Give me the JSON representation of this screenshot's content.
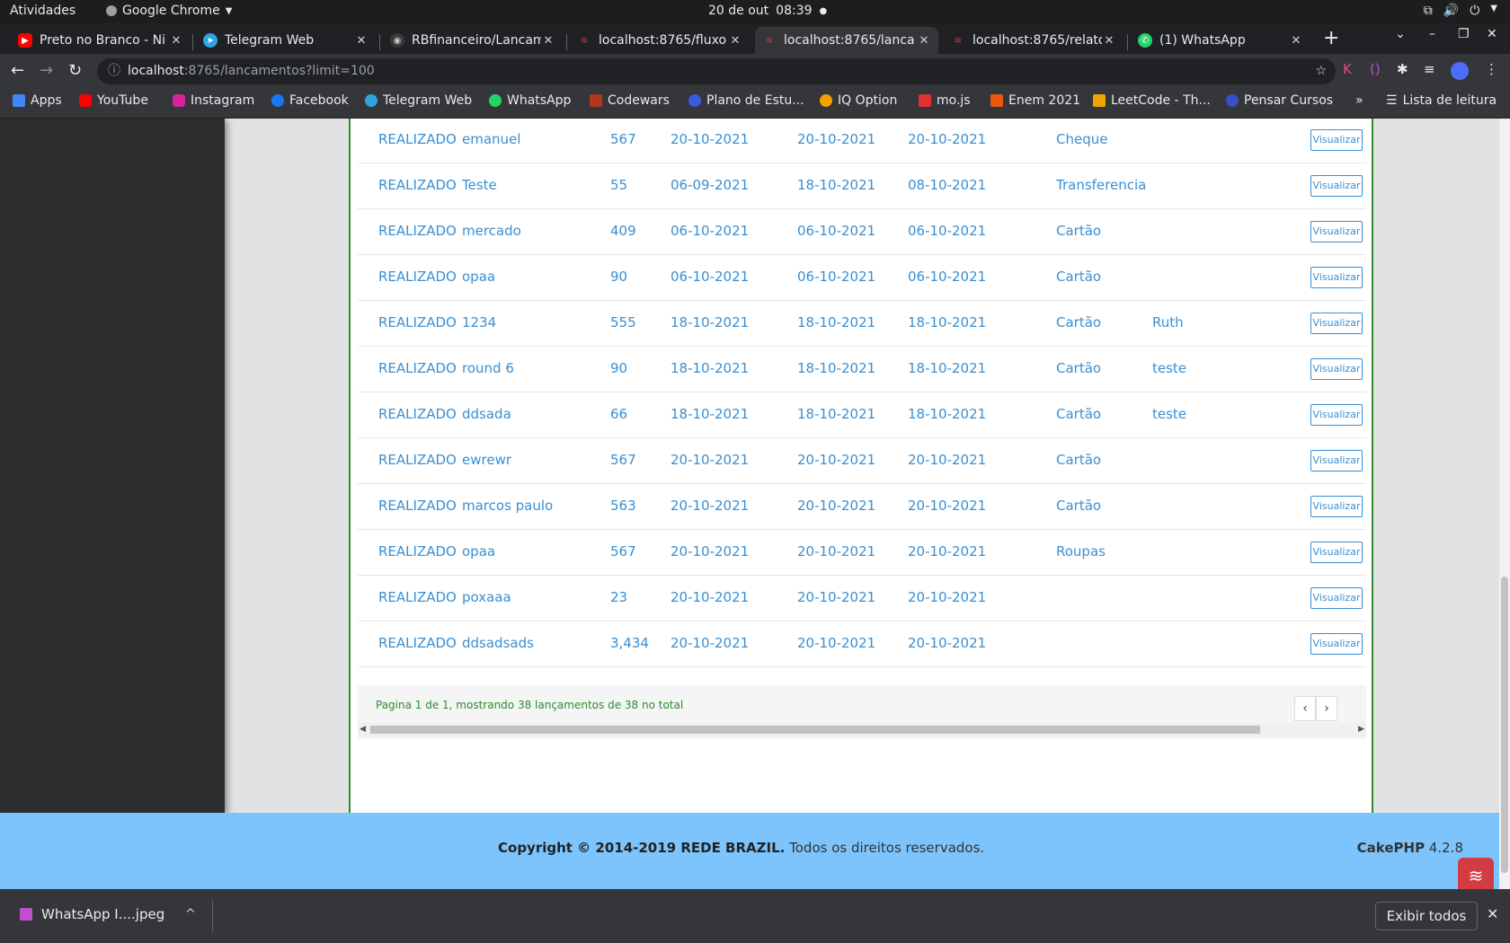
{
  "gnome": {
    "activities": "Atividades",
    "app": "Google Chrome",
    "date": "20 de out",
    "time": "08:39"
  },
  "tabs": [
    {
      "title": "Preto no Branco - Ni",
      "favicon": "youtube-icon",
      "color": "#ff0000"
    },
    {
      "title": "Telegram Web",
      "favicon": "telegram-icon",
      "color": "#2ca5e0"
    },
    {
      "title": "RBfinanceiro/Lancam",
      "favicon": "github-icon",
      "color": "#888888"
    },
    {
      "title": "localhost:8765/fluxo",
      "favicon": "cakephp-icon",
      "color": "#d33c43"
    },
    {
      "title": "localhost:8765/lanca",
      "favicon": "cakephp-icon",
      "color": "#d33c43",
      "active": true
    },
    {
      "title": "localhost:8765/relato",
      "favicon": "cakephp-icon",
      "color": "#d33c43"
    },
    {
      "title": "(1) WhatsApp",
      "favicon": "whatsapp-icon",
      "color": "#25d366"
    }
  ],
  "omnibox": {
    "host": "localhost",
    "rest": ":8765/lancamentos?limit=100"
  },
  "bookmarks": [
    {
      "label": "Apps",
      "icon": "apps-grid-icon",
      "color": "#4285f4"
    },
    {
      "label": "YouTube",
      "icon": "youtube-icon",
      "color": "#ff0000"
    },
    {
      "label": "Instagram",
      "icon": "instagram-icon",
      "color": "#d6249f"
    },
    {
      "label": "Facebook",
      "icon": "facebook-icon",
      "color": "#1877f2"
    },
    {
      "label": "Telegram Web",
      "icon": "telegram-icon",
      "color": "#2ca5e0"
    },
    {
      "label": "WhatsApp",
      "icon": "whatsapp-icon",
      "color": "#25d366"
    },
    {
      "label": "Codewars",
      "icon": "codewars-icon",
      "color": "#b1361e"
    },
    {
      "label": "Plano de Estu...",
      "icon": "plano-icon",
      "color": "#3b5bdb"
    },
    {
      "label": "IQ Option",
      "icon": "iqoption-icon",
      "color": "#f59f00"
    },
    {
      "label": "mo.js",
      "icon": "mojs-icon",
      "color": "#e03131"
    },
    {
      "label": "Enem 2021",
      "icon": "enem-icon",
      "color": "#e8590c"
    },
    {
      "label": "LeetCode - Th...",
      "icon": "leetcode-icon",
      "color": "#f0a400"
    },
    {
      "label": "Pensar Cursos",
      "icon": "pensar-icon",
      "color": "#364fc7"
    }
  ],
  "reading_list": "Lista de leitura",
  "rows": [
    {
      "status": "REALIZADO",
      "desc": "emanuel",
      "valor": "567",
      "d1": "20-10-2021",
      "d2": "20-10-2021",
      "d3": "20-10-2021",
      "categoria": "Cheque",
      "extra": ""
    },
    {
      "status": "REALIZADO",
      "desc": "Teste",
      "valor": "55",
      "d1": "06-09-2021",
      "d2": "18-10-2021",
      "d3": "08-10-2021",
      "categoria": "Transferencia",
      "extra": ""
    },
    {
      "status": "REALIZADO",
      "desc": "mercado",
      "valor": "409",
      "d1": "06-10-2021",
      "d2": "06-10-2021",
      "d3": "06-10-2021",
      "categoria": "Cartão",
      "extra": ""
    },
    {
      "status": "REALIZADO",
      "desc": "opaa",
      "valor": "90",
      "d1": "06-10-2021",
      "d2": "06-10-2021",
      "d3": "06-10-2021",
      "categoria": "Cartão",
      "extra": ""
    },
    {
      "status": "REALIZADO",
      "desc": "1234",
      "valor": "555",
      "d1": "18-10-2021",
      "d2": "18-10-2021",
      "d3": "18-10-2021",
      "categoria": "Cartão",
      "extra": "Ruth"
    },
    {
      "status": "REALIZADO",
      "desc": "round 6",
      "valor": "90",
      "d1": "18-10-2021",
      "d2": "18-10-2021",
      "d3": "18-10-2021",
      "categoria": "Cartão",
      "extra": "teste"
    },
    {
      "status": "REALIZADO",
      "desc": "ddsada",
      "valor": "66",
      "d1": "18-10-2021",
      "d2": "18-10-2021",
      "d3": "18-10-2021",
      "categoria": "Cartão",
      "extra": "teste"
    },
    {
      "status": "REALIZADO",
      "desc": "ewrewr",
      "valor": "567",
      "d1": "20-10-2021",
      "d2": "20-10-2021",
      "d3": "20-10-2021",
      "categoria": "Cartão",
      "extra": ""
    },
    {
      "status": "REALIZADO",
      "desc": "marcos paulo",
      "valor": "563",
      "d1": "20-10-2021",
      "d2": "20-10-2021",
      "d3": "20-10-2021",
      "categoria": "Cartão",
      "extra": ""
    },
    {
      "status": "REALIZADO",
      "desc": "opaa",
      "valor": "567",
      "d1": "20-10-2021",
      "d2": "20-10-2021",
      "d3": "20-10-2021",
      "categoria": "Roupas",
      "extra": ""
    },
    {
      "status": "REALIZADO",
      "desc": "poxaaa",
      "valor": "23",
      "d1": "20-10-2021",
      "d2": "20-10-2021",
      "d3": "20-10-2021",
      "categoria": "",
      "extra": ""
    },
    {
      "status": "REALIZADO",
      "desc": "ddsadsads",
      "valor": "3,434",
      "d1": "20-10-2021",
      "d2": "20-10-2021",
      "d3": "20-10-2021",
      "categoria": "",
      "extra": ""
    }
  ],
  "view_label": "Visualizar",
  "pagination": {
    "text": "Pagina 1 de 1, mostrando 38 lançamentos de 38 no total",
    "prev": "‹",
    "next": "›"
  },
  "footer": {
    "copyright_bold": "Copyright © 2014-2019 REDE BRAZIL.",
    "copyright_rest": " Todos os direitos reservados.",
    "cake_bold": "CakePHP",
    "cake_version": " 4.2.8"
  },
  "download": {
    "filename": "WhatsApp I....jpeg",
    "show_all": "Exibir todos"
  },
  "colors": {
    "link_blue": "#3a8fd1",
    "accent_green": "#2e8b2e",
    "footer_blue": "#7dc4fc"
  }
}
